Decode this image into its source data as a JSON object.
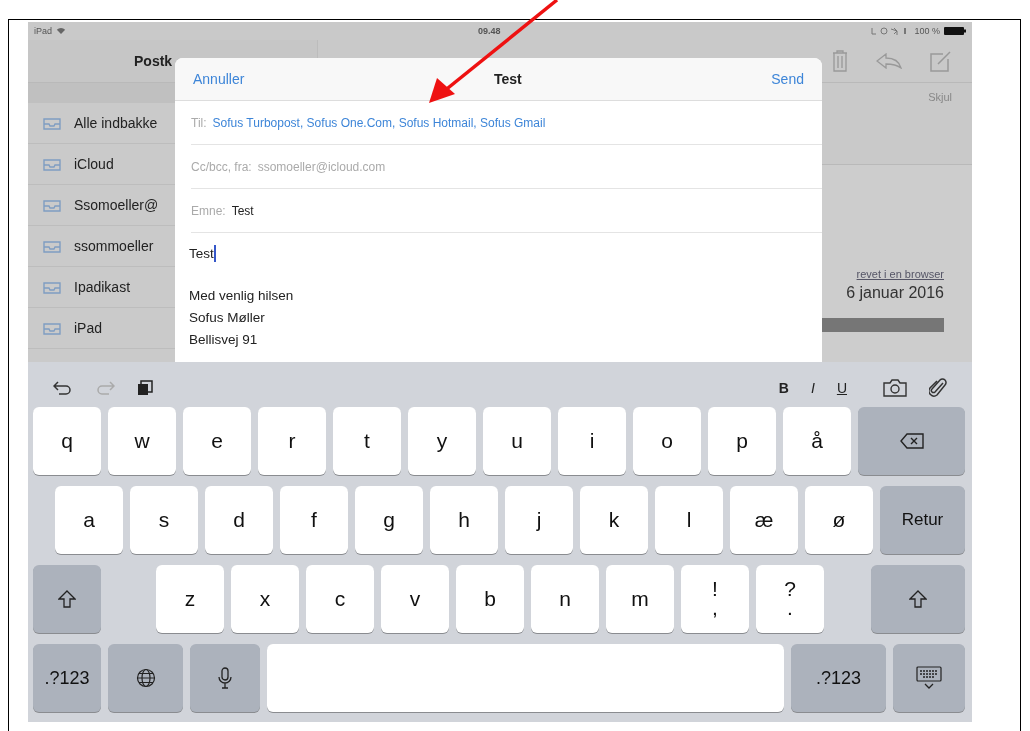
{
  "status_bar": {
    "device": "iPad",
    "time": "09.48",
    "battery": "100 %"
  },
  "mailboxes": {
    "title": "Postk",
    "items": [
      {
        "label": "Alle indbakke"
      },
      {
        "label": "iCloud"
      },
      {
        "label": "Ssomoeller@"
      },
      {
        "label": "ssommoeller"
      },
      {
        "label": "Ipadikast"
      },
      {
        "label": "iPad"
      }
    ]
  },
  "message_pane": {
    "hide_link": "Skjul",
    "browser_link": "revet i en browser",
    "date": "6 januar 2016"
  },
  "compose": {
    "cancel": "Annuller",
    "title": "Test",
    "send": "Send",
    "to_label": "Til:",
    "recipients": "Sofus Turbopost, Sofus One.Com, Sofus Hotmail, Sofus Gmail",
    "ccbcc_label": "Cc/bcc, fra:",
    "from": "ssomoeller@icloud.com",
    "subject_label": "Emne:",
    "subject": "Test",
    "body": "Test",
    "signature": [
      "Med venlig hilsen",
      "Sofus Møller",
      "Bellisvej 91"
    ]
  },
  "format_bar": {
    "bold": "B",
    "italic": "I",
    "underline": "U"
  },
  "keyboard": {
    "rows": [
      [
        {
          "kind": "char",
          "label": "q"
        },
        {
          "kind": "char",
          "label": "w"
        },
        {
          "kind": "char",
          "label": "e"
        },
        {
          "kind": "char",
          "label": "r"
        },
        {
          "kind": "char",
          "label": "t"
        },
        {
          "kind": "char",
          "label": "y"
        },
        {
          "kind": "char",
          "label": "u"
        },
        {
          "kind": "char",
          "label": "i"
        },
        {
          "kind": "char",
          "label": "o"
        },
        {
          "kind": "char",
          "label": "p"
        },
        {
          "kind": "char",
          "label": "å"
        },
        {
          "kind": "delete"
        }
      ],
      [
        {
          "kind": "char",
          "label": "a"
        },
        {
          "kind": "char",
          "label": "s"
        },
        {
          "kind": "char",
          "label": "d"
        },
        {
          "kind": "char",
          "label": "f"
        },
        {
          "kind": "char",
          "label": "g"
        },
        {
          "kind": "char",
          "label": "h"
        },
        {
          "kind": "char",
          "label": "j"
        },
        {
          "kind": "char",
          "label": "k"
        },
        {
          "kind": "char",
          "label": "l"
        },
        {
          "kind": "char",
          "label": "æ"
        },
        {
          "kind": "char",
          "label": "ø"
        },
        {
          "kind": "return",
          "label": "Retur"
        }
      ],
      [
        {
          "kind": "shift"
        },
        {
          "kind": "char",
          "label": "z"
        },
        {
          "kind": "char",
          "label": "x"
        },
        {
          "kind": "char",
          "label": "c"
        },
        {
          "kind": "char",
          "label": "v"
        },
        {
          "kind": "char",
          "label": "b"
        },
        {
          "kind": "char",
          "label": "n"
        },
        {
          "kind": "char",
          "label": "m"
        },
        {
          "kind": "char2",
          "top": "!",
          "bottom": ","
        },
        {
          "kind": "char2",
          "top": "?",
          "bottom": "."
        },
        {
          "kind": "shift"
        }
      ],
      [
        {
          "kind": "mode",
          "label": ".?123"
        },
        {
          "kind": "globe"
        },
        {
          "kind": "mic"
        },
        {
          "kind": "space"
        },
        {
          "kind": "mode",
          "label": ".?123"
        },
        {
          "kind": "hide"
        }
      ]
    ]
  }
}
